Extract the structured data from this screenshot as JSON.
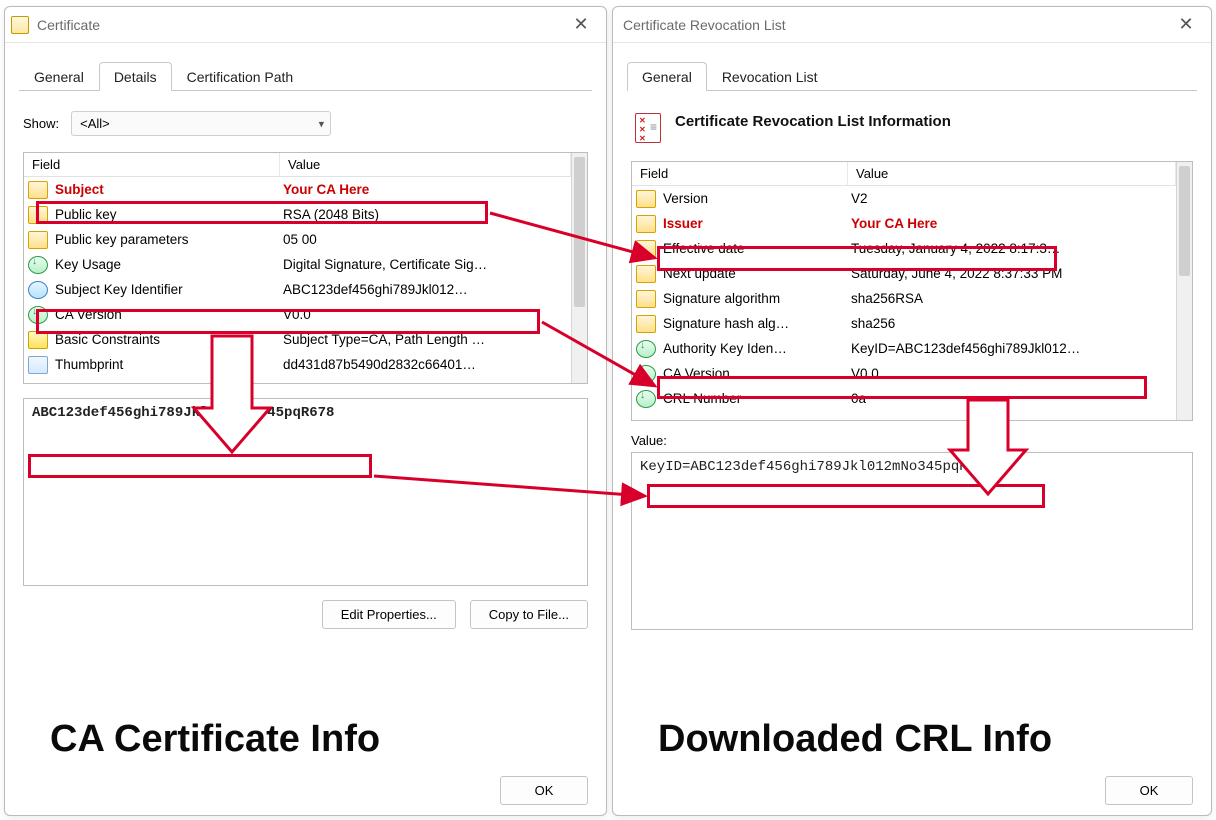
{
  "left": {
    "title": "Certificate",
    "tabs": [
      "General",
      "Details",
      "Certification Path"
    ],
    "activeTab": "Details",
    "showLabel": "Show:",
    "showValue": "<All>",
    "headers": {
      "field": "Field",
      "value": "Value"
    },
    "rows": [
      {
        "icon": "prop",
        "field": "Subject",
        "value": "Your CA Here",
        "highlight": true
      },
      {
        "icon": "prop",
        "field": "Public key",
        "value": "RSA (2048 Bits)"
      },
      {
        "icon": "prop",
        "field": "Public key parameters",
        "value": "05 00"
      },
      {
        "icon": "ext",
        "field": "Key Usage",
        "value": "Digital Signature, Certificate Sig…"
      },
      {
        "icon": "ext2",
        "field": "Subject Key Identifier",
        "value": "ABC123def456ghi789Jkl012…"
      },
      {
        "icon": "ext",
        "field": "CA Version",
        "value": "V0.0"
      },
      {
        "icon": "warn",
        "field": "Basic Constraints",
        "value": "Subject Type=CA, Path Length …"
      },
      {
        "icon": "thumb",
        "field": "Thumbprint",
        "value": "dd431d87b5490d2832c66401…"
      }
    ],
    "detailText": "ABC123def456ghi789Jkl012mNo345pqR678",
    "editBtn": "Edit Properties...",
    "copyBtn": "Copy to File...",
    "okBtn": "OK",
    "caption": "CA Certificate Info"
  },
  "right": {
    "title": "Certificate Revocation List",
    "tabs": [
      "General",
      "Revocation List"
    ],
    "activeTab": "General",
    "infoTitle": "Certificate Revocation List Information",
    "headers": {
      "field": "Field",
      "value": "Value"
    },
    "rows": [
      {
        "icon": "prop",
        "field": "Version",
        "value": "V2"
      },
      {
        "icon": "prop",
        "field": "Issuer",
        "value": "Your CA Here",
        "highlight": true
      },
      {
        "icon": "prop",
        "field": "Effective date",
        "value": "Tuesday, January 4, 2022 8:17:3…"
      },
      {
        "icon": "prop",
        "field": "Next update",
        "value": "Saturday, June 4, 2022 8:37:33 PM"
      },
      {
        "icon": "prop",
        "field": "Signature algorithm",
        "value": "sha256RSA"
      },
      {
        "icon": "prop",
        "field": "Signature hash alg…",
        "value": "sha256"
      },
      {
        "icon": "ext",
        "field": "Authority Key Iden…",
        "value": "KeyID=ABC123def456ghi789Jkl012…"
      },
      {
        "icon": "ext",
        "field": "CA Version",
        "value": "V0.0"
      },
      {
        "icon": "ext",
        "field": "CRL Number",
        "value": "0a"
      }
    ],
    "valueLabel": "Value:",
    "detailText": "KeyID=ABC123def456ghi789Jkl012mNo345pqR678",
    "okBtn": "OK",
    "caption": "Downloaded CRL Info"
  }
}
